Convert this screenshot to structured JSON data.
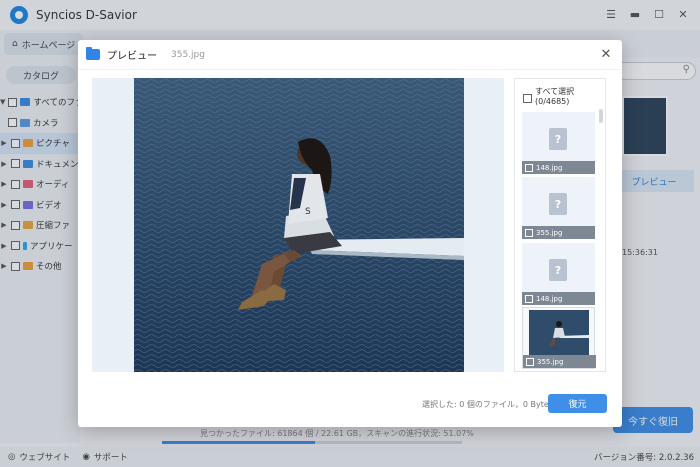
{
  "app": {
    "title": "Syncios D-Savior",
    "nav": {
      "home_label": "ホームページ"
    },
    "sidebar": {
      "catalog_label": "カタログ",
      "items": [
        {
          "label": "すべてのファ",
          "expand": "▼"
        },
        {
          "label": "カメラ",
          "expand": ""
        },
        {
          "label": "ピクチャ",
          "expand": "▶"
        },
        {
          "label": "ドキュメン",
          "expand": "▶"
        },
        {
          "label": "オーディ",
          "expand": "▶"
        },
        {
          "label": "ビデオ",
          "expand": "▶"
        },
        {
          "label": "圧縮ファ",
          "expand": "▶"
        },
        {
          "label": "アプリケー",
          "expand": "▶"
        },
        {
          "label": "その他",
          "expand": "▶"
        }
      ]
    },
    "right_panel": {
      "preview_label": "プレビュー",
      "time_text": "15:36:31"
    },
    "recover_now_label": "今すぐ復旧",
    "scan_status": "見つかったファイル: 61864 個 / 22.61 GB，スキャンの進行状況: 51.07%",
    "scan_progress": 0.5107,
    "footer": {
      "website_label": "ウェブサイト",
      "support_label": "サポート",
      "version": "バージョン番号: 2.0.2.36"
    }
  },
  "dialog": {
    "title": "プレビュー",
    "filename": "355.jpg",
    "close_icon": "close-icon",
    "select_all_label": "すべて選択(0/4685)",
    "files": [
      {
        "name": "148.jpg",
        "thumb": "placeholder"
      },
      {
        "name": "355.jpg",
        "thumb": "placeholder"
      },
      {
        "name": "148.jpg",
        "thumb": "placeholder"
      },
      {
        "name": "355.jpg",
        "thumb": "image"
      }
    ],
    "selection_status": "選択した: 0 個のファイル，0 Byte",
    "restore_label": "復元"
  },
  "colors": {
    "accent": "#3f8ee8",
    "folder": "#2f86e8"
  }
}
